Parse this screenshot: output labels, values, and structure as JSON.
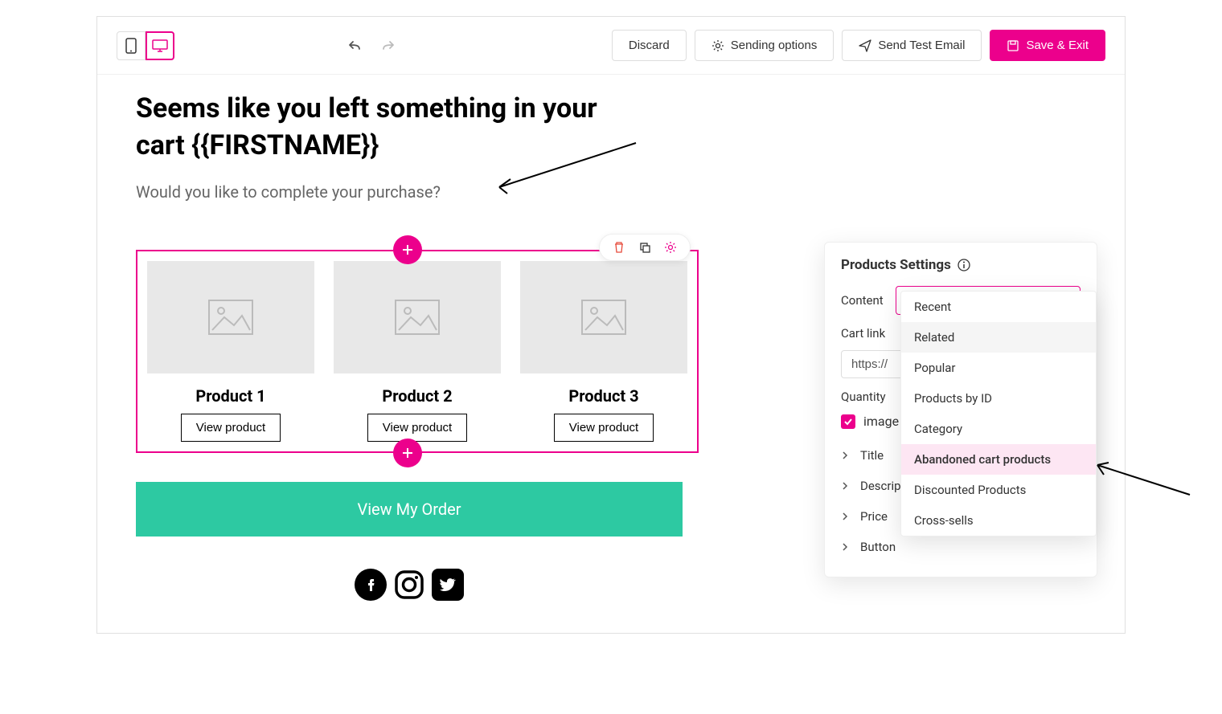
{
  "toolbar": {
    "discard": "Discard",
    "sending": "Sending options",
    "sendTest": "Send Test Email",
    "save": "Save & Exit"
  },
  "email": {
    "heading": "Seems like you left something in your cart {{FIRSTNAME}}",
    "subhead": "Would you like to complete your purchase?",
    "products": [
      {
        "title": "Product 1",
        "button": "View product"
      },
      {
        "title": "Product 2",
        "button": "View product"
      },
      {
        "title": "Product 3",
        "button": "View product"
      }
    ],
    "cta": "View My Order"
  },
  "panel": {
    "title": "Products Settings",
    "contentLabel": "Content",
    "contentValue": "Abandoned cart products",
    "cartLinkLabel": "Cart link",
    "cartLink": "https://",
    "quantityLabel": "Quantity",
    "imageLabel": "image",
    "items": [
      "Title",
      "Description",
      "Price",
      "Button"
    ]
  },
  "dropdown": {
    "options": [
      "Recent",
      "Related",
      "Popular",
      "Products by ID",
      "Category",
      "Abandoned cart products",
      "Discounted Products",
      "Cross-sells"
    ],
    "selected": "Abandoned cart products",
    "hover": "Related"
  }
}
